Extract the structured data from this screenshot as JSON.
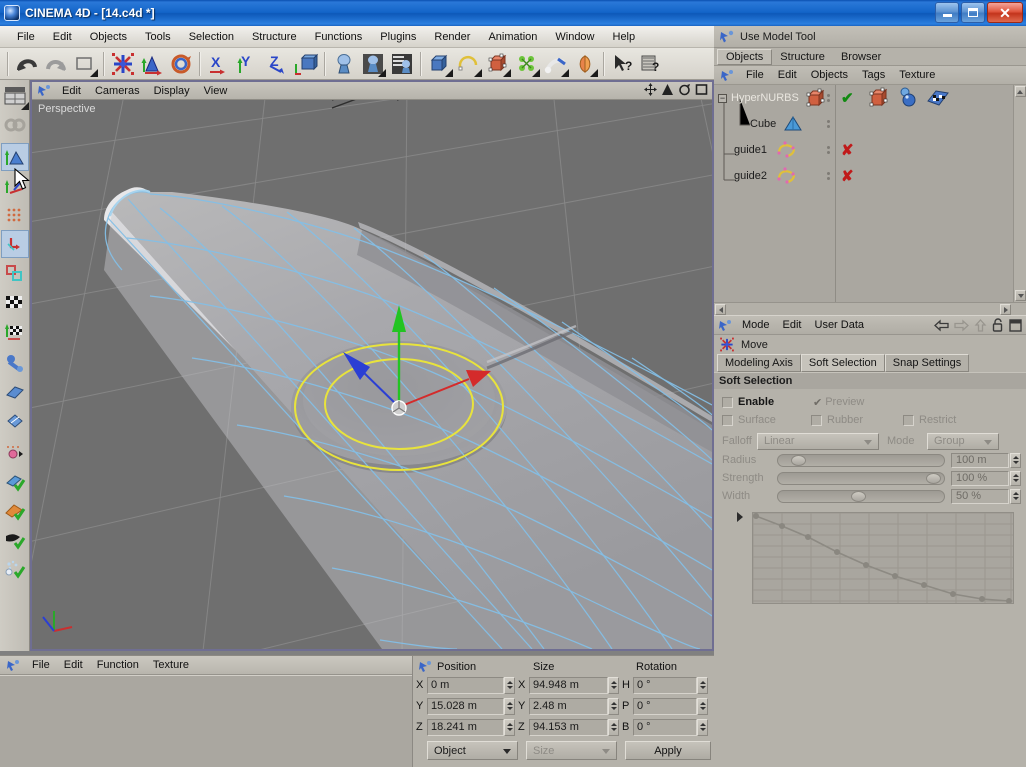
{
  "window": {
    "title": "CINEMA 4D - [14.c4d *]",
    "app_icon": "cinema4d-logo-icon",
    "buttons": {
      "minimize": "minimize-button",
      "maximize": "maximize-button",
      "close": "close-button"
    }
  },
  "menubar": {
    "items": [
      "File",
      "Edit",
      "Objects",
      "Tools",
      "Selection",
      "Structure",
      "Functions",
      "Plugins",
      "Render",
      "Animation",
      "Window",
      "Help"
    ]
  },
  "toolbar": {
    "icons": [
      "undo-icon",
      "redo-icon",
      "select-live-icon",
      "move-tool-icon",
      "scale-tool-icon",
      "rotate-tool-icon",
      "x-axis-lock-icon",
      "y-axis-lock-icon",
      "z-axis-lock-icon",
      "world-object-axis-icon",
      "render-view-icon",
      "render-region-icon",
      "render-settings-icon",
      "cube-primitive-icon",
      "spline-icon",
      "hypernurbs-icon",
      "array-icon",
      "deformer-icon",
      "light-icon",
      "selection-pointer-help-icon",
      "scene-help-icon"
    ]
  },
  "left_palette": {
    "icons": [
      "layout-presets-icon",
      "undo-view-icon",
      "point-mode-icon",
      "edge-mode-icon",
      "polygon-mode-icon",
      "model-mode-icon",
      "object-axis-mode-icon",
      "texture-mode-icon",
      "texture-axis-mode-icon",
      "enable-axis-modification-icon",
      "lock-workplane-icon",
      "viewport-solo-icon",
      "animation-mode-icon",
      "texture-tag-icon",
      "uv-points-mode-icon",
      "uv-polygons-mode-icon",
      "brush-mode-icon",
      "magnet-mode-icon"
    ],
    "selected_index": 2
  },
  "viewport": {
    "menu": [
      "Edit",
      "Cameras",
      "Display",
      "View"
    ],
    "menu_icon": "viewport-tool-icon",
    "label": "Perspective",
    "corner_icons": [
      "pan-view-icon",
      "zoom-view-icon",
      "rotate-view-icon",
      "maximize-view-icon"
    ],
    "axis_gizmo": {
      "x_color": "#d42b2b",
      "y_color": "#22c422",
      "z_color": "#2b3fd4",
      "soft_selection_ring_color": "#e8e33c"
    },
    "grid_color": "#8c8c8c",
    "mesh_wire_color": "#8fc4e8",
    "background_color": "#6f6f6f"
  },
  "materials_panel": {
    "menu_icon": "material-tool-icon",
    "menu": [
      "File",
      "Edit",
      "Function",
      "Texture"
    ]
  },
  "coordinates": {
    "icon": "coordinates-tool-icon",
    "headers": {
      "position": "Position",
      "size": "Size",
      "rotation": "Rotation"
    },
    "rows": [
      {
        "pos_axis": "X",
        "pos_value": "0 m",
        "size_axis": "X",
        "size_value": "94.948 m",
        "rot_axis": "H",
        "rot_value": "0 °"
      },
      {
        "pos_axis": "Y",
        "pos_value": "15.028 m",
        "size_axis": "Y",
        "size_value": "2.48 m",
        "rot_axis": "P",
        "rot_value": "0 °"
      },
      {
        "pos_axis": "Z",
        "pos_value": "18.241 m",
        "size_axis": "Z",
        "size_value": "94.153 m",
        "rot_axis": "B",
        "rot_value": "0 °"
      }
    ],
    "mode_select": "Object",
    "size_select": "Size",
    "apply_button": "Apply"
  },
  "right_panel": {
    "use_model_tool": {
      "label": "Use Model Tool",
      "icon": "model-tool-icon"
    },
    "tabs": [
      {
        "label": "Objects",
        "active": true
      },
      {
        "label": "Structure",
        "active": false
      },
      {
        "label": "Browser",
        "active": false
      }
    ],
    "object_menu": {
      "icon": "objects-tool-icon",
      "items": [
        "File",
        "Edit",
        "Objects",
        "Tags",
        "Texture"
      ]
    },
    "tree": [
      {
        "name": "HyperNURBS",
        "icon": "hypernurbs-object-icon",
        "expander": "-",
        "indent": 0,
        "highlighted": true,
        "state": "visible-check",
        "tags": [
          "cube-tag-icon",
          "material-tag-icon",
          "texture-tag-icon"
        ]
      },
      {
        "name": "Cube",
        "icon": "cube-object-icon",
        "expander": "",
        "indent": 1,
        "highlighted": false,
        "state": "none",
        "tags": []
      },
      {
        "name": "guide1",
        "icon": "spline-object-icon",
        "expander": "",
        "indent": 0,
        "highlighted": false,
        "state": "hidden-x",
        "tags": []
      },
      {
        "name": "guide2",
        "icon": "spline-object-icon",
        "expander": "",
        "indent": 0,
        "highlighted": false,
        "state": "hidden-x",
        "tags": []
      }
    ],
    "attributes": {
      "menu": [
        "Mode",
        "Edit",
        "User Data"
      ],
      "menu_icon": "attributes-tool-icon",
      "nav_icons": [
        "back-arrow-icon",
        "forward-arrow-icon",
        "up-level-icon",
        "lock-icon",
        "panel-layout-icon"
      ],
      "tool_name": "Move",
      "tool_icon": "move-tool-icon",
      "tabs": [
        {
          "label": "Modeling Axis",
          "active": false
        },
        {
          "label": "Soft Selection",
          "active": true
        },
        {
          "label": "Snap Settings",
          "active": false
        }
      ],
      "section_title": "Soft Selection",
      "checkboxes": [
        {
          "label": "Enable",
          "checked": false,
          "enabled": true
        },
        {
          "label": "Preview",
          "checked": true,
          "enabled": false
        },
        {
          "label": "Surface",
          "checked": false,
          "enabled": false
        },
        {
          "label": "Rubber",
          "checked": false,
          "enabled": false
        },
        {
          "label": "Restrict",
          "checked": false,
          "enabled": false
        }
      ],
      "falloff": {
        "label": "Falloff",
        "value": "Linear"
      },
      "mode": {
        "label": "Mode",
        "value": "Group"
      },
      "sliders": [
        {
          "label": "Radius",
          "value": "100 m",
          "percent": 8
        },
        {
          "label": "Strength",
          "value": "100 %",
          "percent": 95
        },
        {
          "label": "Width",
          "value": "50 %",
          "percent": 47
        }
      ],
      "curve": {
        "expander": "triangle-right-icon",
        "points": [
          [
            0,
            0
          ],
          [
            0.11,
            0.14
          ],
          [
            0.22,
            0.27
          ],
          [
            0.33,
            0.43
          ],
          [
            0.44,
            0.58
          ],
          [
            0.55,
            0.7
          ],
          [
            0.66,
            0.8
          ],
          [
            0.77,
            0.9
          ],
          [
            0.88,
            0.95
          ],
          [
            1.0,
            1.0
          ]
        ]
      }
    }
  }
}
